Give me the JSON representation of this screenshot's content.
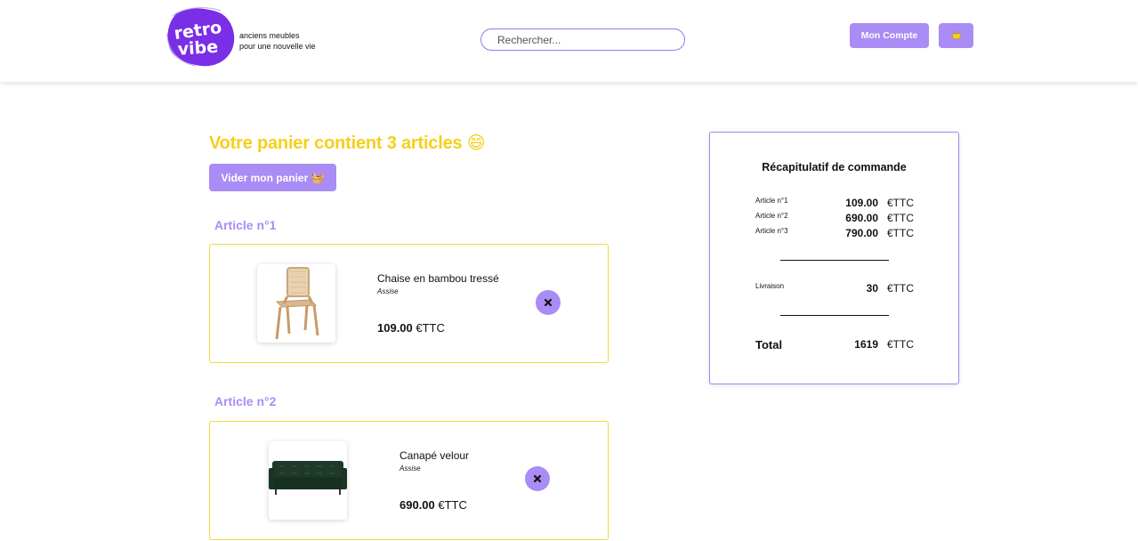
{
  "header": {
    "logo_text_1": "retro",
    "logo_text_2": "vibe",
    "tagline_1": "anciens meubles",
    "tagline_2": "pour une nouvelle vie",
    "search_placeholder": "Rechercher...",
    "account_label": "Mon Compte",
    "cart_icon": "basket-icon"
  },
  "cart": {
    "title": "Votre panier contient 3 articles 😄",
    "empty_label": "Vider mon panier 🧺",
    "articles": [
      {
        "heading": "Article n°1",
        "name": "Chaise en bambou tressé",
        "category": "Assise",
        "price": "109.00",
        "unit": "€TTC",
        "image": "chair-image"
      },
      {
        "heading": "Article n°2",
        "name": "Canapé velour",
        "category": "Assise",
        "price": "690.00",
        "unit": "€TTC",
        "image": "sofa-image"
      }
    ]
  },
  "summary": {
    "title": "Récapitulatif de commande",
    "items": [
      {
        "label": "Article n°1",
        "value": "109.00",
        "unit": "€TTC"
      },
      {
        "label": "Article n°2",
        "value": "690.00",
        "unit": "€TTC"
      },
      {
        "label": "Article n°3",
        "value": "790.00",
        "unit": "€TTC"
      }
    ],
    "shipping": {
      "label": "Livraison",
      "value": "30",
      "unit": "€TTC"
    },
    "total": {
      "label": "Total",
      "value": "1619",
      "unit": "€TTC"
    }
  },
  "colors": {
    "accent": "#a98cf5",
    "title_yellow": "#f6cf1c",
    "card_border": "#f6d93a",
    "summary_border": "#9b8cf0"
  }
}
